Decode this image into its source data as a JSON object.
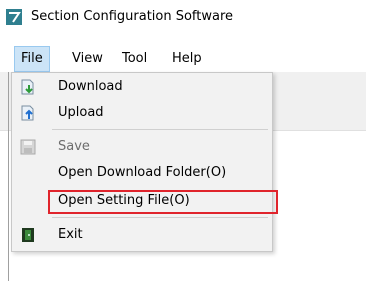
{
  "window": {
    "title": "Section Configuration Software",
    "icon": "app-logo-icon"
  },
  "menubar": {
    "items": [
      {
        "label": "File",
        "active": true
      },
      {
        "label": "View"
      },
      {
        "label": "Tool"
      },
      {
        "label": "Help"
      }
    ]
  },
  "file_menu": {
    "items": [
      {
        "label": "Download",
        "icon": "download-icon",
        "enabled": true
      },
      {
        "label": "Upload",
        "icon": "upload-icon",
        "enabled": true
      },
      {
        "label": "Save",
        "icon": "save-icon",
        "enabled": false
      },
      {
        "label": "Open Download Folder(O)",
        "enabled": true
      },
      {
        "label": "Open Setting File(O)",
        "enabled": true,
        "highlighted": true
      },
      {
        "label": "Exit",
        "icon": "exit-icon",
        "enabled": true
      }
    ],
    "highlight_color": "#e0242c"
  }
}
